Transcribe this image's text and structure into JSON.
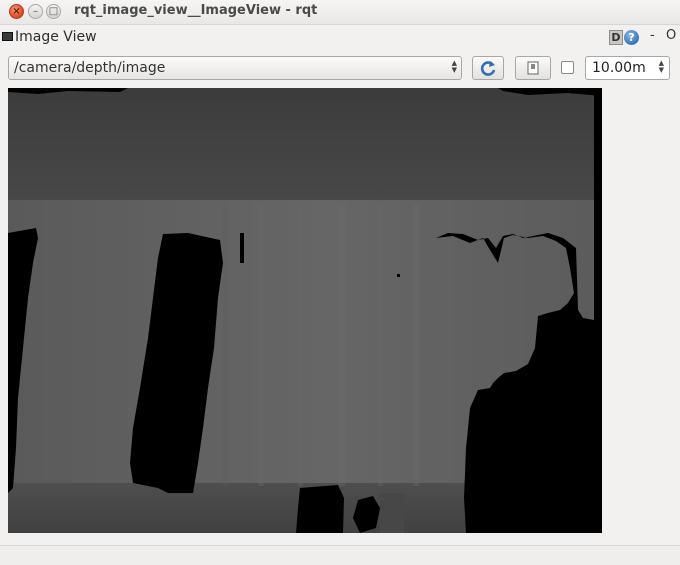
{
  "window": {
    "title": "rqt_image_view__ImageView - rqt",
    "close_glyph": "×",
    "minimize_glyph": "–",
    "maximize_glyph": "□"
  },
  "plugin": {
    "title": "Image View",
    "d_label": "D",
    "help_label": "?",
    "close_label": "-",
    "float_label": "O"
  },
  "toolbar": {
    "topic_value": "/camera/depth/image",
    "combo_arrows_icon": "up-down-arrows-icon",
    "refresh_icon": "refresh-icon",
    "save_icon": "save-icon",
    "checkbox_checked": false,
    "max_range_value": "10.00m"
  },
  "colors": {
    "refresh_blue": "#2f6fb4",
    "depth_far": "#3a3a3a",
    "depth_near": "#636363",
    "no_data": "#000000"
  }
}
